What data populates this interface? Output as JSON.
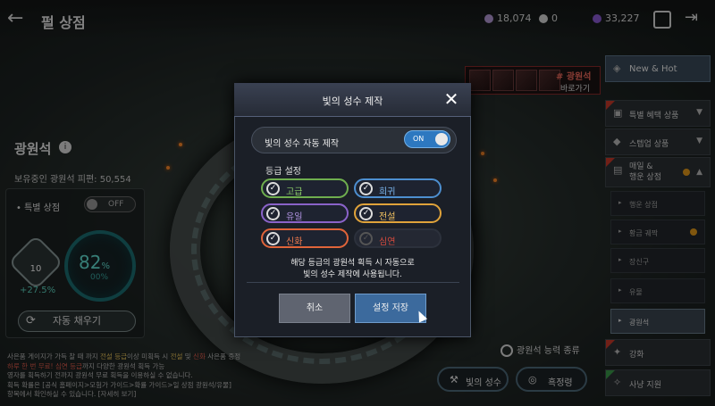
{
  "header": {
    "title": "펄 상점",
    "currencies": [
      {
        "icon": "pearl-gem-icon",
        "value": "18,074",
        "color": "#b49ad6"
      },
      {
        "icon": "silver-coin-icon",
        "value": "0",
        "color": "#d8d8d8"
      },
      {
        "icon": "purple-gem-icon",
        "value": "33,227",
        "color": "#8b5cd6"
      }
    ]
  },
  "left_panel": {
    "title": "광원석",
    "owned_label": "보유중인 광원석 피편: 50,554",
    "special_shop_label": "특별 상점",
    "special_shop_toggle": "OFF",
    "level": "10",
    "level_change": "+27.5%",
    "gauge_percent": "82",
    "gauge_percent_unit": "%",
    "gauge_sub": "00%",
    "refill_button": "자동 채우기",
    "notes": {
      "l1a": "사은품 게이지가 가득 찰 때 까지 ",
      "l1b": "전설 등급",
      "l1c": "이상 미획득 시 ",
      "l1d": "전설",
      "l1e": " 및 ",
      "l1f": "신화",
      "l1g": " 사은품 증정",
      "l2a": "하루 한 번 무료! 심연 등급",
      "l2b": "까지 다양한 광원석 획득 가능",
      "l3": "영자를 획득하기 전까지 광원석 무료 획득을 이용하실 수 없습니다.",
      "l4": "획득 확률은 [공식 홈페이지>모험가 가이드>확률 가이드>일 상점 광원석/유물]",
      "l5": "항목에서 확인하실 수 있습니다. [자세히 보기]"
    }
  },
  "lightstone_link": {
    "title": "# 광원석",
    "subtitle": "바로가기"
  },
  "sidebar": {
    "new_hot": "New & Hot",
    "items": [
      {
        "label": "특별 혜택 상품",
        "icon": "gift-icon"
      },
      {
        "label": "스텝업 상품",
        "icon": "box-icon"
      },
      {
        "label": "매일 &",
        "label2": "행운 상점",
        "icon": "daily-shop-icon"
      }
    ],
    "sub_items": [
      {
        "label": "행운 상점"
      },
      {
        "label": "황금 궤짝"
      },
      {
        "label": "장신구"
      },
      {
        "label": "유물"
      },
      {
        "label": "광원석"
      }
    ],
    "bottom_items": [
      {
        "label": "강화",
        "icon": "enhance-icon"
      },
      {
        "label": "사냥 지원",
        "icon": "hunt-support-icon"
      }
    ]
  },
  "bottom_right": {
    "search_detail": "광원석 능력 종류",
    "star_craft_button": "빛의 성수",
    "stamp_button": "흑정령"
  },
  "dialog": {
    "title": "빛의 성수 제작",
    "auto_label": "빛의 성수 자동 제작",
    "auto_toggle": "ON",
    "grade_title": "등급 설정",
    "grades": [
      {
        "label": "고급",
        "color": "#6fae4e",
        "checked": true
      },
      {
        "label": "희귀",
        "color": "#4d8fd0",
        "checked": true
      },
      {
        "label": "유일",
        "color": "#8a63c9",
        "checked": true
      },
      {
        "label": "전설",
        "color": "#e0a33a",
        "checked": true
      },
      {
        "label": "신화",
        "color": "#e0643a",
        "checked": true
      },
      {
        "label": "심연",
        "color": "#d63a3a",
        "checked": false
      }
    ],
    "description_1": "해당 등급의 광원석 획득 시 자동으로",
    "description_2": "빛의 성수 제작에 사용됩니다.",
    "cancel_button": "취소",
    "save_button": "설정 저장"
  }
}
